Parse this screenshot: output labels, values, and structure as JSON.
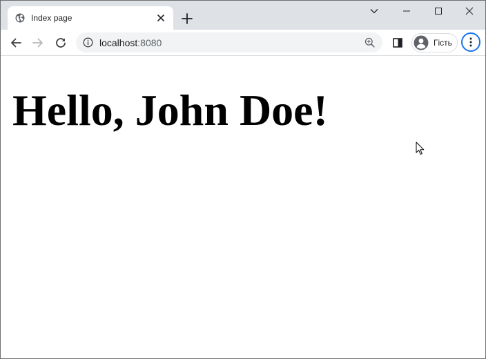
{
  "tab": {
    "title": "Index page",
    "favicon_icon": "globe-icon",
    "close_icon": "close-icon"
  },
  "tabstrip": {
    "new_tab_icon": "plus-icon"
  },
  "window_controls": {
    "tab_search_icon": "chevron-down-icon",
    "minimize_icon": "minimize-icon",
    "maximize_icon": "maximize-icon",
    "close_icon": "close-icon"
  },
  "toolbar": {
    "back_icon": "arrow-left-icon",
    "forward_icon": "arrow-right-icon",
    "reload_icon": "reload-icon",
    "side_panel_icon": "side-panel-icon",
    "menu_icon": "kebab-menu-icon"
  },
  "omnibox": {
    "host": "localhost",
    "port": ":8080",
    "info_icon": "info-icon",
    "zoom_icon": "zoom-in-icon"
  },
  "profile": {
    "label": "Гість",
    "avatar_icon": "person-icon"
  },
  "page": {
    "heading": "Hello, John Doe!"
  },
  "colors": {
    "tabstrip_bg": "#dee1e6",
    "omnibox_bg": "#f1f3f4",
    "menu_focus_ring": "#1a73e8",
    "icon": "#5f6368"
  }
}
